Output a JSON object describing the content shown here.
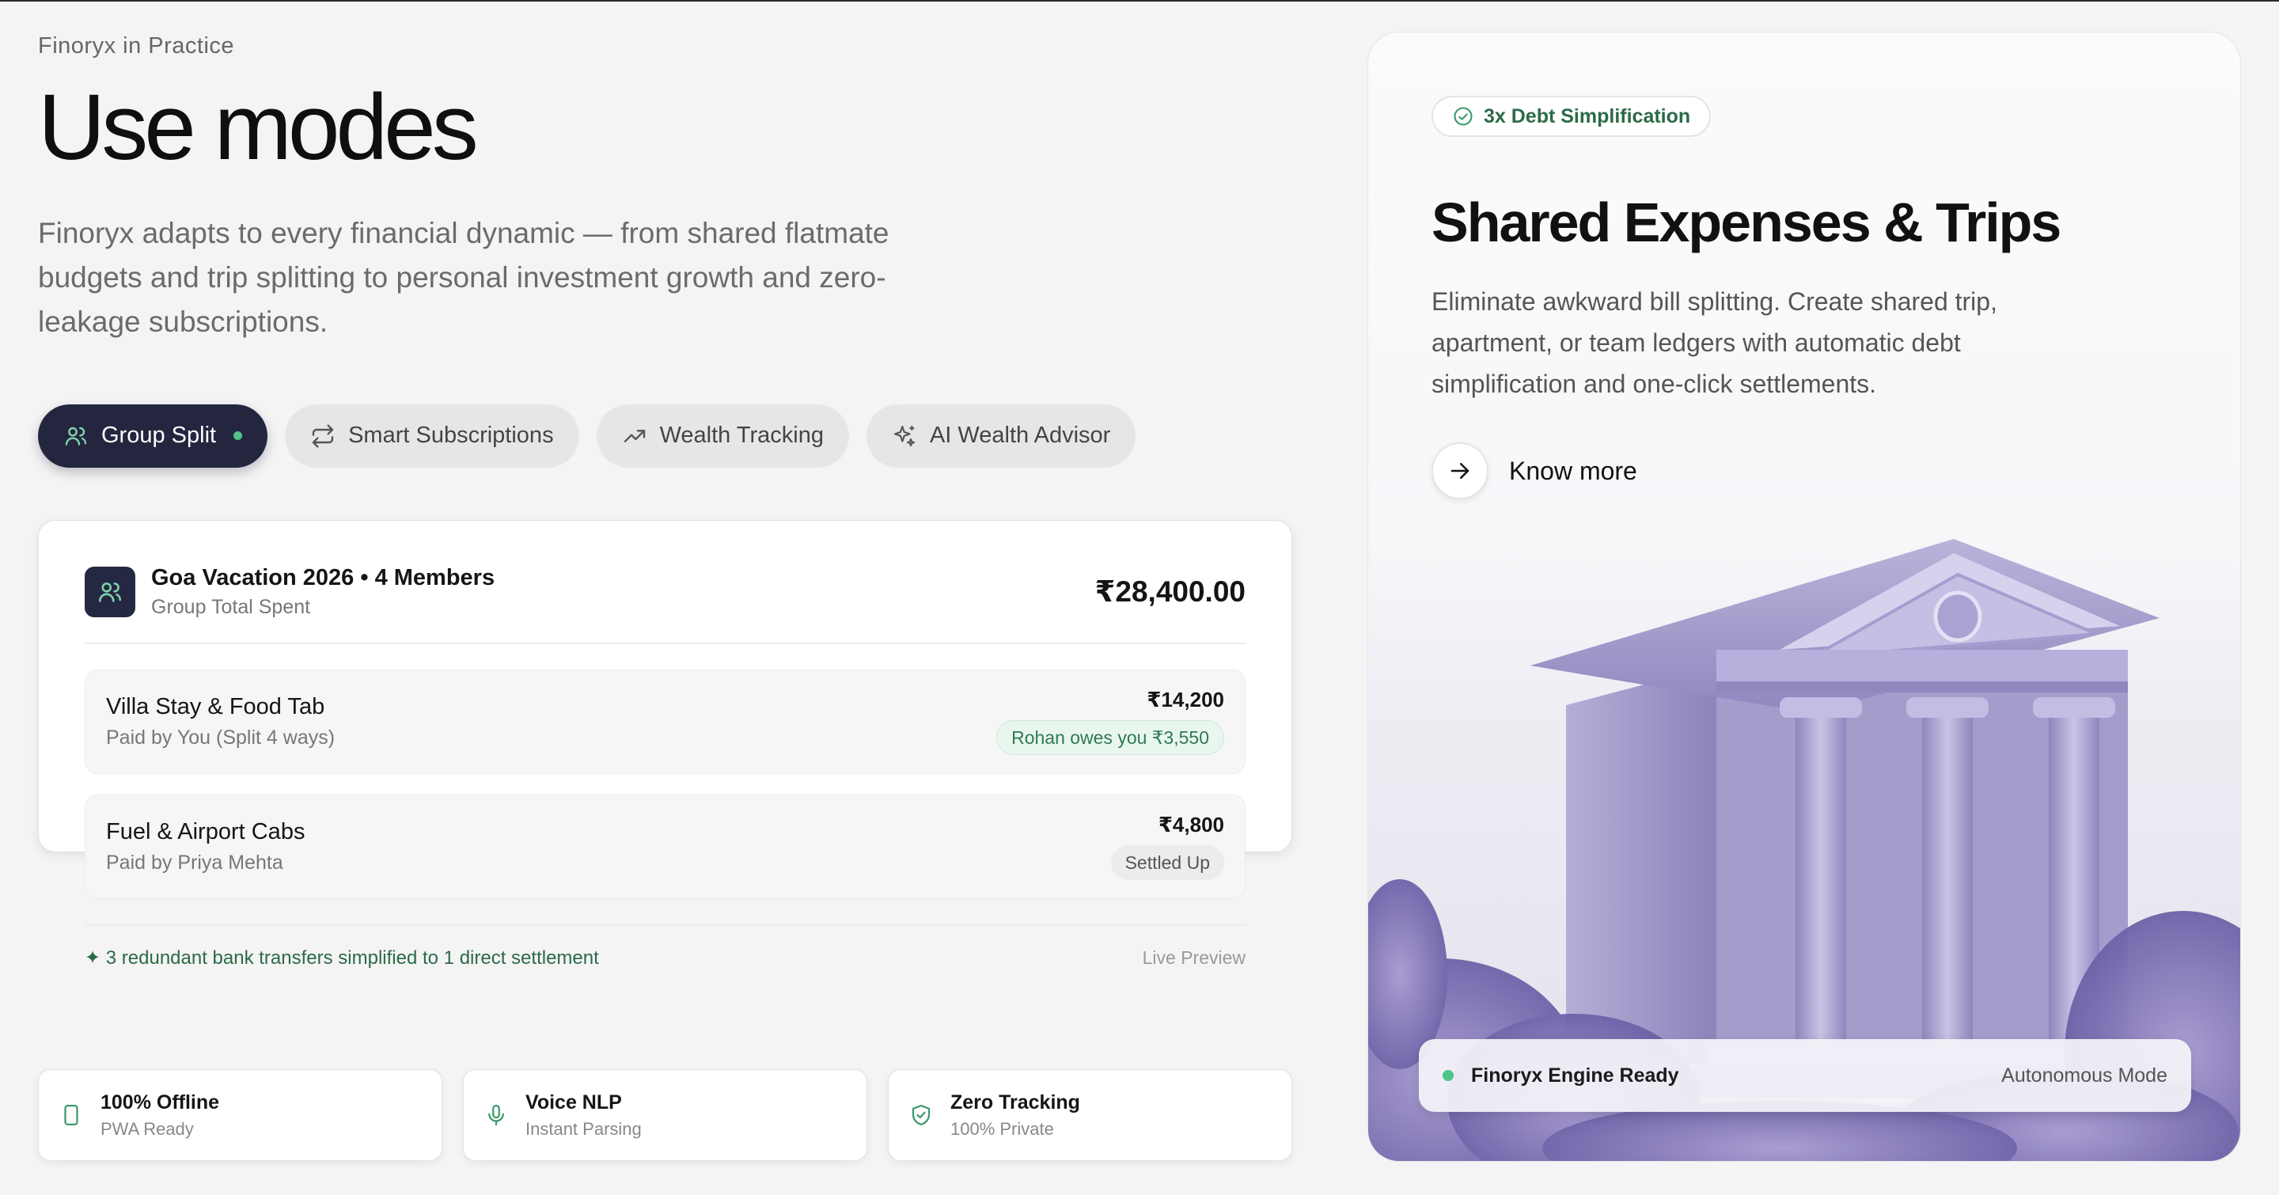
{
  "header": {
    "eyebrow": "Finoryx in Practice",
    "title": "Use modes",
    "description": "Finoryx adapts to every financial dynamic — from shared flatmate budgets and trip splitting to personal investment growth and zero-leakage subscriptions."
  },
  "tabs": [
    {
      "label": "Group Split",
      "icon": "users-icon",
      "active": true
    },
    {
      "label": "Smart Subscriptions",
      "icon": "repeat-icon",
      "active": false
    },
    {
      "label": "Wealth Tracking",
      "icon": "trending-up-icon",
      "active": false
    },
    {
      "label": "AI Wealth Advisor",
      "icon": "sparkles-icon",
      "active": false
    }
  ],
  "group_card": {
    "name": "Goa Vacation 2026 • 4 Members",
    "subtitle": "Group Total Spent",
    "total": "₹28,400.00",
    "expenses": [
      {
        "title": "Villa Stay & Food Tab",
        "subtitle": "Paid by You (Split 4 ways)",
        "amount": "₹14,200",
        "status": "Rohan owes you ₹3,550"
      },
      {
        "title": "Fuel & Airport Cabs",
        "subtitle": "Paid by Priya Mehta",
        "amount": "₹4,800",
        "status": "Settled Up"
      }
    ],
    "footer_note": "✦ 3 redundant bank transfers simplified to 1 direct settlement",
    "live_label": "Live Preview"
  },
  "features": [
    {
      "title": "100% Offline",
      "subtitle": "PWA Ready",
      "icon": "phone-icon"
    },
    {
      "title": "Voice NLP",
      "subtitle": "Instant Parsing",
      "icon": "mic-icon"
    },
    {
      "title": "Zero Tracking",
      "subtitle": "100% Private",
      "icon": "shield-check-icon"
    }
  ],
  "detail_panel": {
    "badge": "3x Debt Simplification",
    "title": "Shared Expenses & Trips",
    "description": "Eliminate awkward bill splitting. Create shared trip, apartment, or team ledgers with automatic debt simplification and one-click settlements.",
    "cta_label": "Know more",
    "status_label": "Finoryx Engine Ready",
    "status_mode": "Autonomous Mode"
  },
  "colors": {
    "active_tab": "#242640",
    "accent_green": "#4fc38a",
    "green_text": "#2b6a47"
  }
}
